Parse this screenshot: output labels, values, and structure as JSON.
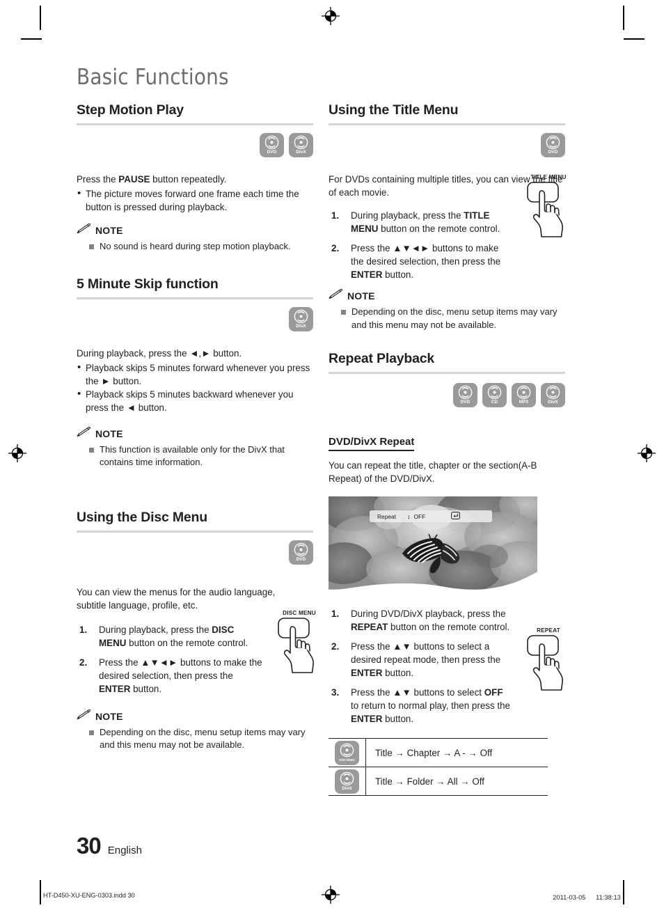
{
  "page": {
    "chapter_title": "Basic Functions",
    "page_number": "30",
    "language": "English",
    "footer_file": "HT-D450-XU-ENG-0303.indd   30",
    "footer_timestamp": "2011-03-05   　 11:38:13"
  },
  "left_column": {
    "section1": {
      "heading": "Step Motion Play",
      "badges": [
        "DVD",
        "DivX"
      ],
      "intro": "Press the PAUSE button repeatedly.",
      "intro_parts": [
        {
          "t": "Press the ",
          "b": false
        },
        {
          "t": "PAUSE",
          "b": true
        },
        {
          "t": " button repeatedly.",
          "b": false
        }
      ],
      "bullets": [
        "The picture moves forward one frame each time the button is pressed during playback."
      ],
      "note_label": "NOTE",
      "notes": [
        "No sound is heard during step motion playback."
      ]
    },
    "section2": {
      "heading": "5 Minute Skip function",
      "badges": [
        "DivX"
      ],
      "intro": "During playback, press the ◄,► button.",
      "bullets": [
        "Playback skips 5 minutes forward whenever you press the ► button.",
        "Playback skips 5 minutes backward whenever you press the ◄ button."
      ],
      "note_label": "NOTE",
      "notes": [
        "This function is available only for the DivX that contains time information."
      ]
    },
    "section3": {
      "heading": "Using the Disc Menu",
      "badges": [
        "DVD"
      ],
      "intro": "You can view the menus for the audio language, subtitle language, profile, etc.",
      "button_caption": "DISC MENU",
      "steps": [
        {
          "num": "1.",
          "parts": [
            {
              "t": "During playback, press the ",
              "b": false
            },
            {
              "t": "DISC MENU",
              "b": true
            },
            {
              "t": " button on the remote control.",
              "b": false
            }
          ]
        },
        {
          "num": "2.",
          "parts": [
            {
              "t": "Press the ",
              "b": false
            },
            {
              "t": "▲▼◄►",
              "b": false
            },
            {
              "t": " buttons to make the desired selection, then press the ",
              "b": false
            },
            {
              "t": "ENTER",
              "b": true
            },
            {
              "t": " button.",
              "b": false
            }
          ]
        }
      ],
      "note_label": "NOTE",
      "notes": [
        "Depending on the disc, menu setup items may vary and this menu may not be available."
      ]
    }
  },
  "right_column": {
    "section1": {
      "heading": "Using the Title Menu",
      "badges": [
        "DVD"
      ],
      "intro": "For DVDs containing multiple titles, you can view the title of each movie.",
      "button_caption": "TITLE MENU",
      "steps": [
        {
          "num": "1.",
          "parts": [
            {
              "t": "During playback, press the ",
              "b": false
            },
            {
              "t": "TITLE MENU",
              "b": true
            },
            {
              "t": " button on the remote control.",
              "b": false
            }
          ]
        },
        {
          "num": "2.",
          "parts": [
            {
              "t": "Press the ",
              "b": false
            },
            {
              "t": "▲▼◄►",
              "b": false
            },
            {
              "t": " buttons to make the desired selection, then press the ",
              "b": false
            },
            {
              "t": "ENTER",
              "b": true
            },
            {
              "t": " button.",
              "b": false
            }
          ]
        }
      ],
      "note_label": "NOTE",
      "notes": [
        "Depending on the disc, menu setup items may vary and this menu may not be available."
      ]
    },
    "section2": {
      "heading": "Repeat Playback",
      "badges": [
        "DVD",
        "CD",
        "MP3",
        "DivX"
      ],
      "subheading": "DVD/DivX Repeat",
      "intro": "You can repeat the title, chapter or the section(A-B Repeat) of the DVD/DivX.",
      "screenshot": {
        "osd_label": "Repeat",
        "osd_arrows": "↕",
        "osd_value": "OFF",
        "osd_enter_icon": "enter-icon",
        "alt": "butterfly-on-flowers-photo"
      },
      "button_caption": "REPEAT",
      "steps": [
        {
          "num": "1.",
          "parts": [
            {
              "t": "During DVD/DivX playback, press the ",
              "b": false
            },
            {
              "t": "REPEAT",
              "b": true
            },
            {
              "t": " button on the remote control.",
              "b": false
            }
          ]
        },
        {
          "num": "2.",
          "parts": [
            {
              "t": "Press the ",
              "b": false
            },
            {
              "t": "▲▼",
              "b": false
            },
            {
              "t": " buttons to select a desired repeat mode, then press the ",
              "b": false
            },
            {
              "t": "ENTER",
              "b": true
            },
            {
              "t": " button.",
              "b": false
            }
          ]
        },
        {
          "num": "3.",
          "parts": [
            {
              "t": "Press the ",
              "b": false
            },
            {
              "t": "▲▼",
              "b": false
            },
            {
              "t": " buttons to select ",
              "b": false
            },
            {
              "t": "OFF",
              "b": true
            },
            {
              "t": " to return to normal play, then press the ",
              "b": false
            },
            {
              "t": "ENTER",
              "b": true
            },
            {
              "t": " button.",
              "b": false
            }
          ]
        }
      ],
      "table": {
        "rows": [
          {
            "icon_label": "DVD-VIDEO",
            "sequence": "Title → Chapter → A - → Off"
          },
          {
            "icon_label": "DivX",
            "sequence": "Title → Folder → All → Off"
          }
        ]
      }
    }
  }
}
